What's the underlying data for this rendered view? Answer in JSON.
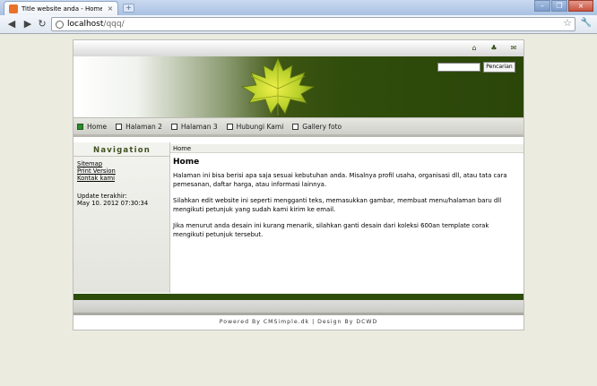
{
  "browser": {
    "tab_title": "Title website anda - Home",
    "tab_close": "×",
    "new_tab": "+",
    "url_host": "localhost",
    "url_path": "/qqq/",
    "window_buttons": [
      "–",
      "❐",
      "×"
    ]
  },
  "site": {
    "top_icons": [
      "home-icon",
      "sitemap-icon",
      "mail-icon"
    ],
    "search_button": "Pencarian",
    "menu": [
      {
        "label": "Home",
        "active": true
      },
      {
        "label": "Halaman 2",
        "active": false
      },
      {
        "label": "Halaman 3",
        "active": false
      },
      {
        "label": "Hubungi Kami",
        "active": false
      },
      {
        "label": "Gallery foto",
        "active": false
      }
    ],
    "sidebar": {
      "title": "Navigation",
      "links": [
        "Sitemap",
        "Print Version",
        "Kontak kami"
      ],
      "updated_label": "Update terakhir:",
      "updated_value": "May 10. 2012 07:30:34"
    },
    "breadcrumb": "Home",
    "content_title": "Home",
    "paragraphs": [
      "Halaman ini bisa berisi apa saja sesuai kebutuhan anda. Misalnya profil usaha, organisasi dll, atau tata cara pemesanan, daftar harga, atau informasi lainnya.",
      "Silahkan edit website ini seperti mengganti teks, memasukkan gambar, membuat menu/halaman baru dll mengikuti petunjuk yang sudah kami kirim ke email.",
      "Jika menurut anda desain ini kurang menarik, silahkan ganti desain dari koleksi 600an template corak mengikuti petunjuk tersebut."
    ],
    "credits": "Powered By CMSimple.dk | Design By DCWD"
  },
  "colors": {
    "dark_green": "#2e4c0a",
    "active_menu": "#2b8a2b",
    "nav_title": "#415221"
  }
}
